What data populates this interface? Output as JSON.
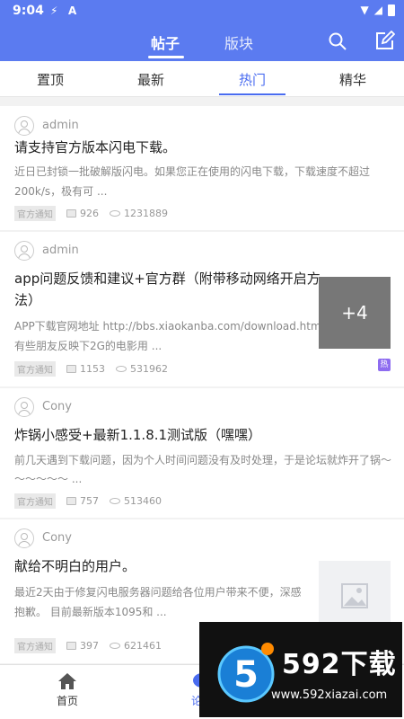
{
  "status_bar": {
    "time": "9:04",
    "icons": [
      "flash-icon",
      "a-icon",
      "wifi-icon",
      "signal-icon",
      "battery-icon"
    ]
  },
  "header": {
    "tabs": [
      {
        "label": "帖子",
        "active": true
      },
      {
        "label": "版块",
        "active": false
      }
    ],
    "actions": [
      "search-icon",
      "edit-icon"
    ]
  },
  "subtabs": [
    {
      "label": "置顶",
      "active": false
    },
    {
      "label": "最新",
      "active": false
    },
    {
      "label": "热门",
      "active": true
    },
    {
      "label": "精华",
      "active": false
    }
  ],
  "posts": [
    {
      "author": "admin",
      "title": "请支持官方版本闪电下载。",
      "excerpt_lines": [
        "近日已封锁一批破解版闪电。如果您正在使用的闪电下载，下载速度不超过",
        "200k/s，极有可 ..."
      ],
      "tag": "官方通知",
      "comments": "926",
      "views": "1231889"
    },
    {
      "author": "admin",
      "title_lines": [
        "app问题反馈和建议+官方群（附带移动网络开启方",
        "法）"
      ],
      "excerpt_lines": [
        "APP下载官网地址 http://bbs.xiaokanba.com/download.html",
        "有些朋友反映下2G的电影用 ..."
      ],
      "tag": "官方通知",
      "comments": "1153",
      "views": "531962",
      "thumb_overlay": "+4",
      "badge": "热"
    },
    {
      "author": "Cony",
      "title": "炸锅小感受+最新1.1.8.1测试版（嘿嘿）",
      "excerpt_lines": [
        "前几天遇到下载问题，因为个人时间问题没有及时处理，于是论坛就炸开了锅～",
        "～～～～～ ..."
      ],
      "tag": "官方通知",
      "comments": "757",
      "views": "513460"
    },
    {
      "author": "Cony",
      "title": "献给不明白的用户。",
      "excerpt_lines": [
        "最近2天由于修复闪电服务器问题给各位用户带来不便，深感",
        "抱歉。 目前最新版本1095和 ..."
      ],
      "tag": "官方通知",
      "comments": "397",
      "views": "621461",
      "thumb_placeholder": "image-icon"
    }
  ],
  "bottom_nav": [
    {
      "label": "首页",
      "icon": "home-icon"
    },
    {
      "label": "论坛",
      "icon": "chat-icon"
    }
  ],
  "watermark": {
    "brand": "592下载",
    "url": "www.592xiazai.com",
    "logo_digit": "5"
  },
  "colors": {
    "primary": "#5b7bf0",
    "accent": "#4a6cf0",
    "badge": "#8e6cf0"
  }
}
